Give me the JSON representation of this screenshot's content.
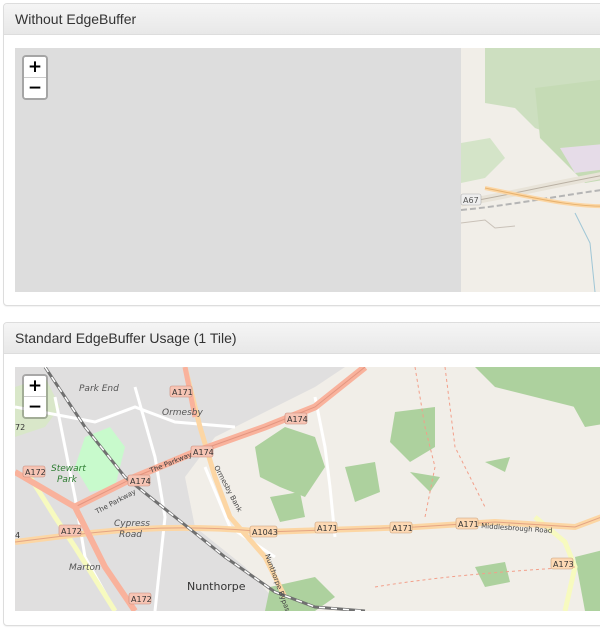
{
  "panels": [
    {
      "title": "Without EdgeBuffer",
      "zoom_in": "+",
      "zoom_out": "−",
      "road_labels": [
        "A67"
      ]
    },
    {
      "title": "Standard EdgeBuffer Usage (1 Tile)",
      "zoom_in": "+",
      "zoom_out": "−",
      "road_labels": [
        "A171",
        "A174",
        "A174",
        "A174",
        "A172",
        "A172",
        "A172",
        "A1043",
        "A171",
        "A171",
        "A171",
        "A173",
        "72",
        "4"
      ],
      "place_labels": [
        "Park End",
        "Ormesby",
        "Stewart",
        "Park",
        "Cypress",
        "Road",
        "Marton",
        "Nunthorpe"
      ],
      "street_labels": [
        "The Parkway",
        "The Parkway",
        "Ormesby Bank",
        "Nunthorpe Bypass",
        "Middlesbrough Road"
      ]
    }
  ]
}
